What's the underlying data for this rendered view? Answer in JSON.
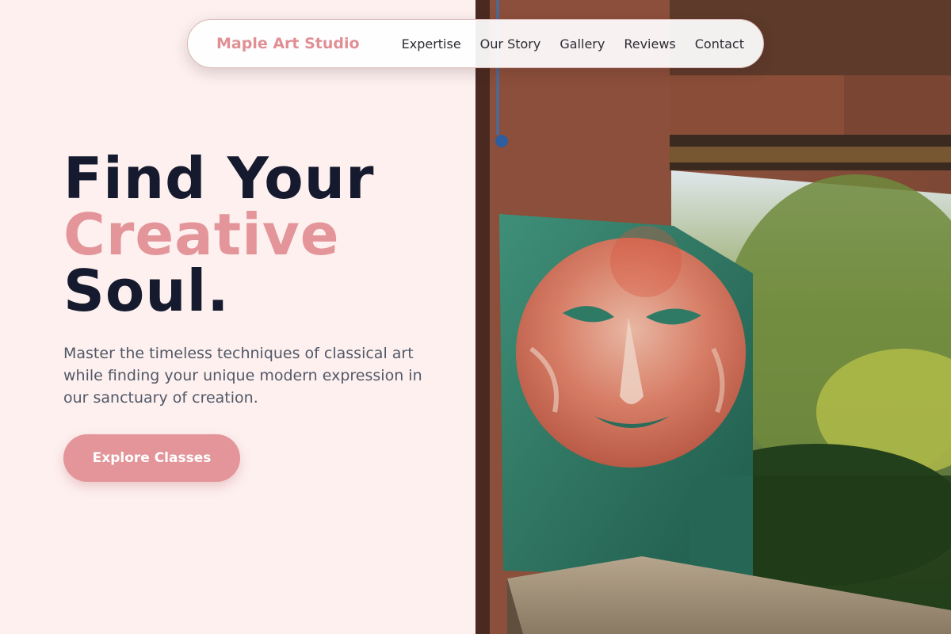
{
  "brand": {
    "name": "Maple Art Studio"
  },
  "nav": {
    "links": [
      "Expertise",
      "Our Story",
      "Gallery",
      "Reviews",
      "Contact"
    ]
  },
  "hero": {
    "title_line1": "Find Your",
    "title_line2": "Creative",
    "title_line3": "Soul.",
    "subtitle": "Master the timeless techniques of classical art while finding your unique modern expression in our sanctuary of creation.",
    "cta_label": "Explore Classes"
  },
  "colors": {
    "accent": "#e3959a",
    "heading": "#151a2e",
    "body_text": "#515867",
    "background": "#fdf0ef"
  },
  "image": {
    "subject": "painted-face-sculpture-icon"
  }
}
